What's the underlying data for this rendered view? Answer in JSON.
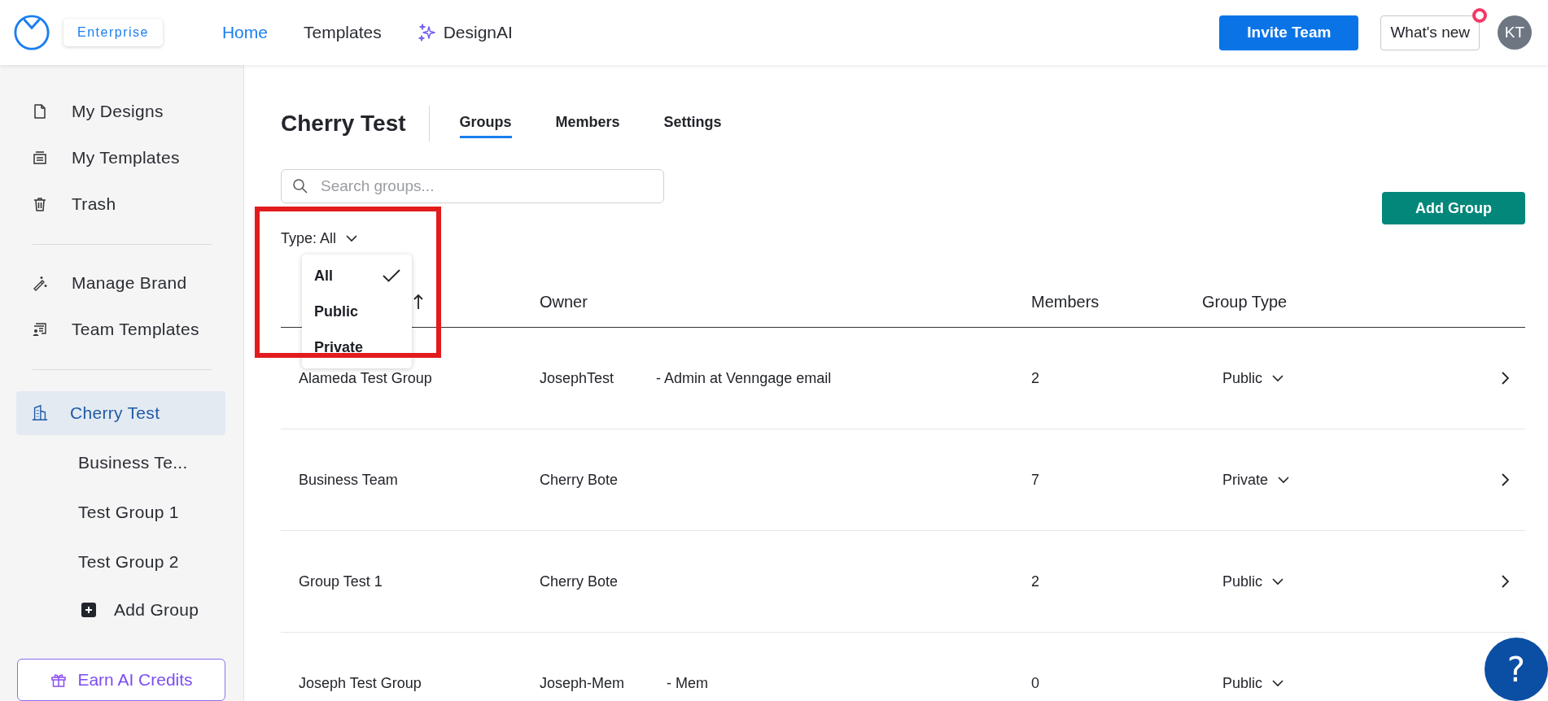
{
  "header": {
    "edition_badge": "Enterprise",
    "nav": [
      {
        "label": "Home",
        "selected": true,
        "kind": "plain"
      },
      {
        "label": "Templates",
        "selected": false,
        "kind": "plain"
      },
      {
        "label": "DesignAI",
        "selected": false,
        "kind": "ai"
      }
    ],
    "invite_button": "Invite Team",
    "whats_new": {
      "label": "What's new",
      "unread": true
    },
    "avatar": "KT"
  },
  "sidebar": {
    "main": [
      {
        "label": "My Designs"
      },
      {
        "label": "My Templates"
      },
      {
        "label": "Trash"
      }
    ],
    "brand": [
      {
        "label": "Manage Brand"
      },
      {
        "label": "Team Templates"
      }
    ],
    "team": {
      "label": "Cherry Test",
      "selected": true
    },
    "groups": [
      {
        "label": "Business Te...",
        "selected": false
      },
      {
        "label": "Test Group 1",
        "selected": false
      },
      {
        "label": "Test Group 2",
        "selected": false
      }
    ],
    "add_group": "Add Group",
    "credits_button": "Earn AI Credits"
  },
  "page": {
    "title": "Cherry Test",
    "tabs": [
      {
        "label": "Groups",
        "selected": true
      },
      {
        "label": "Members",
        "selected": false
      },
      {
        "label": "Settings",
        "selected": false
      }
    ],
    "search": {
      "placeholder": "Search groups..."
    },
    "add_button": "Add Group",
    "filter": {
      "label": "Type: All",
      "menu": [
        {
          "label": "All",
          "selected": true
        },
        {
          "label": "Public",
          "selected": false
        },
        {
          "label": "Private",
          "selected": false
        }
      ]
    },
    "table": {
      "first_column": {
        "sorted_ascending": true
      },
      "columns": [
        "Owner",
        "Members",
        "Group Type"
      ],
      "rows": [
        {
          "name": "Alameda Test Group",
          "owner": [
            "JosephTest",
            "- Admin at Venngage email"
          ],
          "members": "2",
          "type": "Public"
        },
        {
          "name": "Business Team",
          "owner": [
            "Cherry Bote"
          ],
          "members": "7",
          "type": "Private"
        },
        {
          "name": "Group Test 1",
          "owner": [
            "Cherry Bote"
          ],
          "members": "2",
          "type": "Public"
        },
        {
          "name": "Joseph Test Group",
          "owner": [
            "Joseph-Mem",
            "- Mem"
          ],
          "members": "0",
          "type": "Public"
        }
      ]
    }
  },
  "help_button": "?"
}
